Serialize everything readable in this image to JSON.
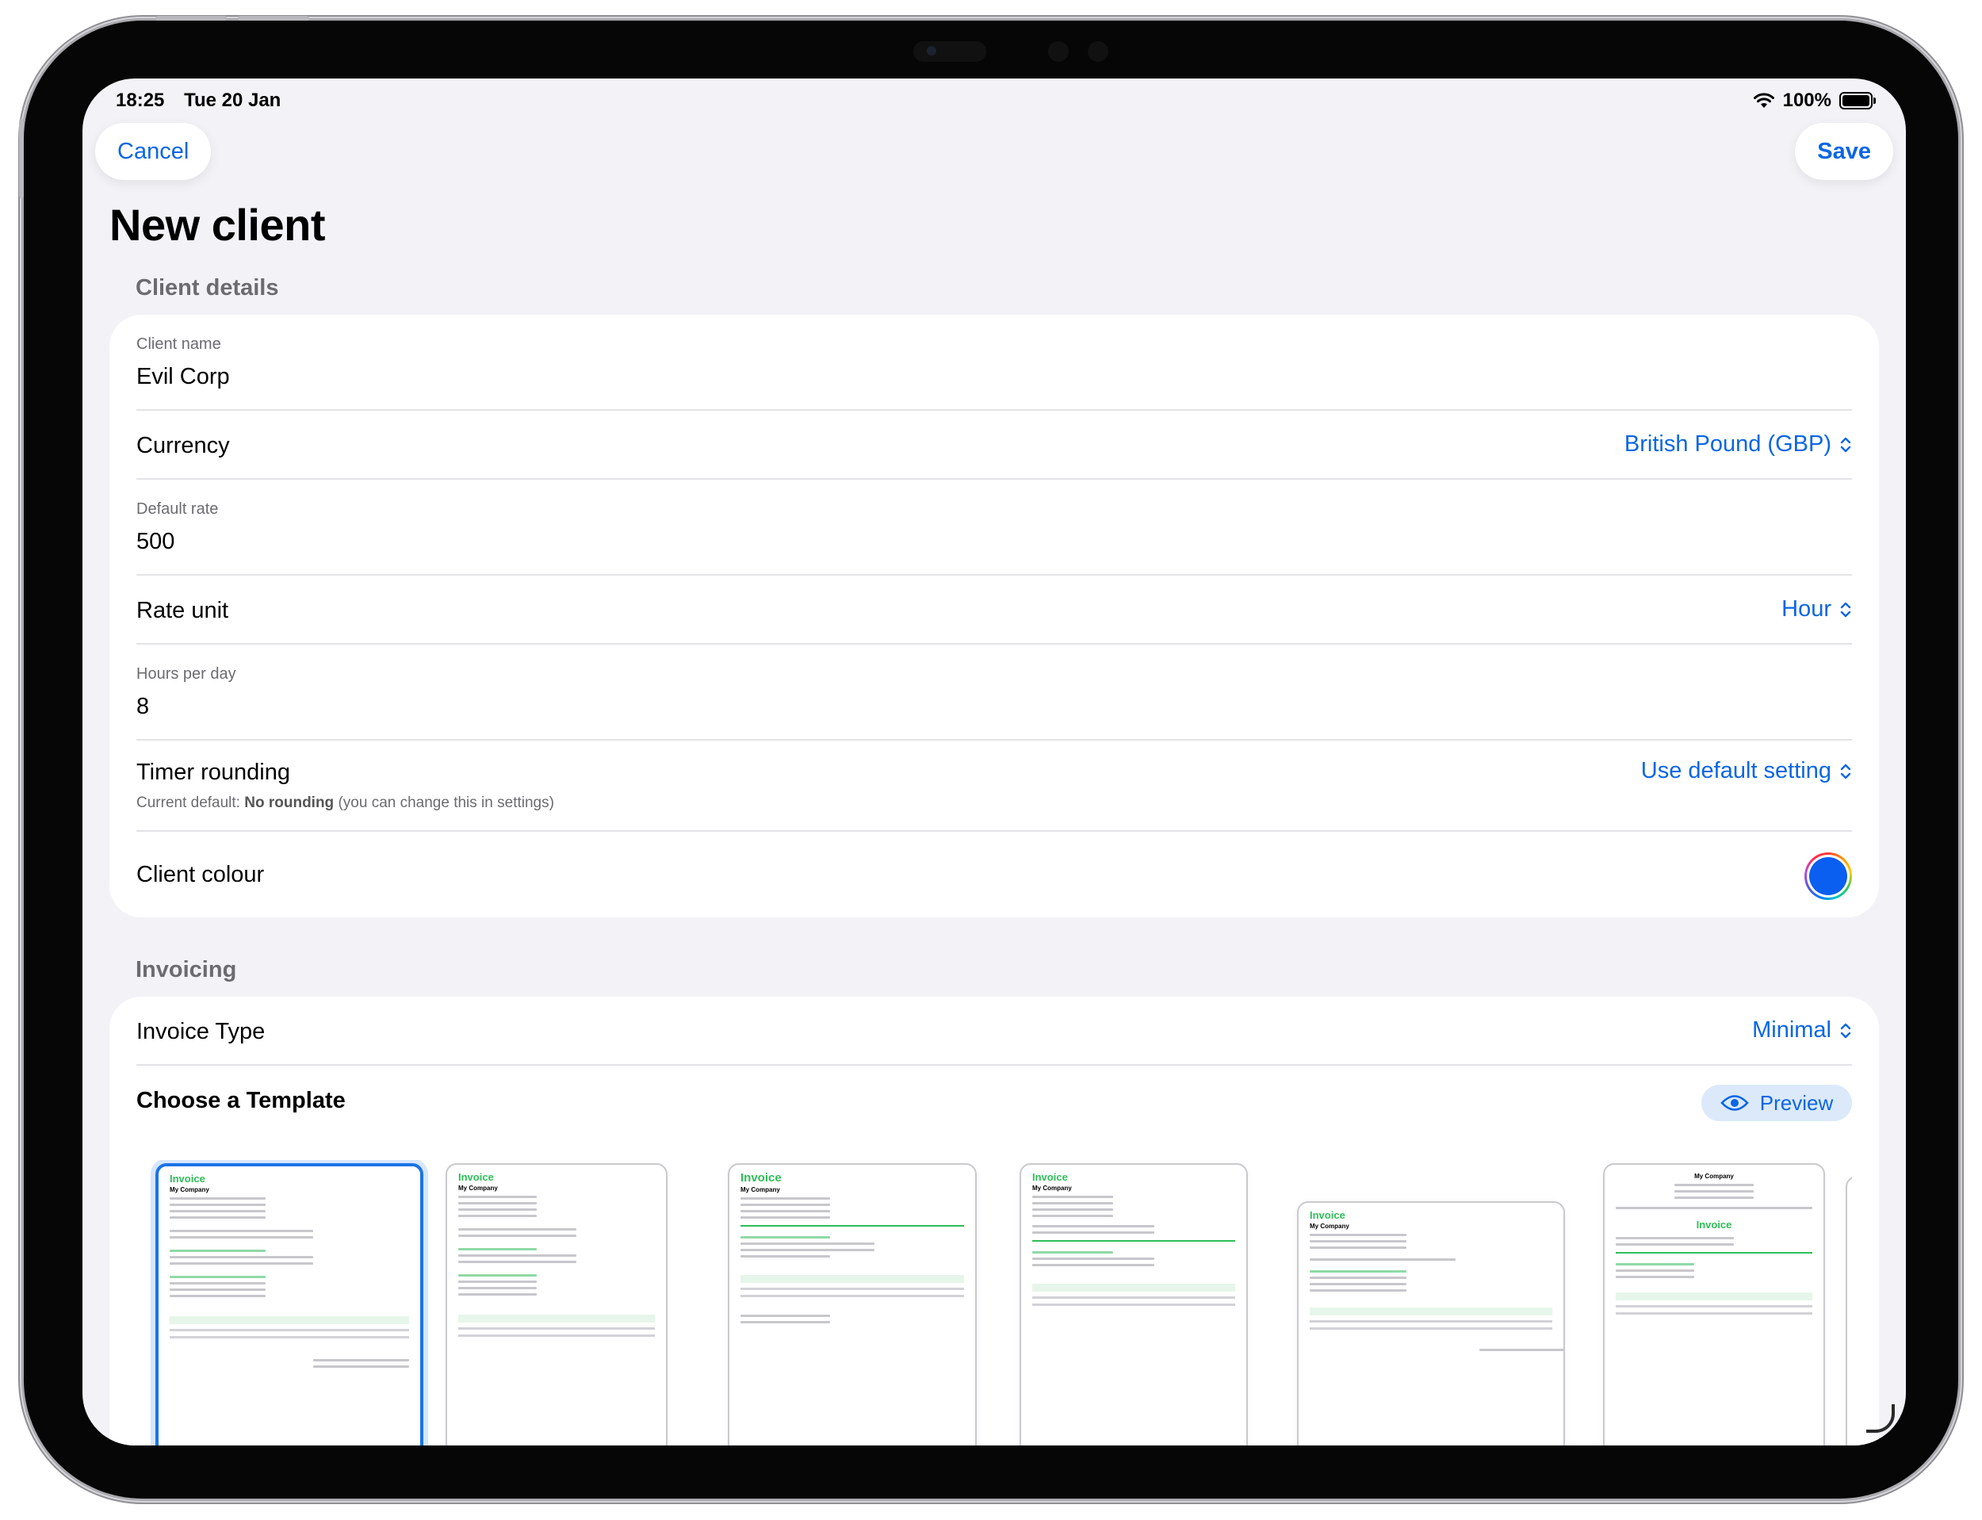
{
  "status_bar": {
    "time": "18:25",
    "date": "Tue 20 Jan",
    "battery": "100%"
  },
  "nav": {
    "cancel_label": "Cancel",
    "save_label": "Save",
    "title": "New client"
  },
  "client_details": {
    "section_label": "Client details",
    "client_name": {
      "label": "Client name",
      "value": "Evil Corp"
    },
    "currency": {
      "label": "Currency",
      "value": "British Pound (GBP)"
    },
    "default_rate": {
      "label": "Default rate",
      "value": "500"
    },
    "rate_unit": {
      "label": "Rate unit",
      "value": "Hour"
    },
    "hours_per_day": {
      "label": "Hours per day",
      "value": "8"
    },
    "timer_rounding": {
      "label": "Timer rounding",
      "value": "Use default setting",
      "sub_prefix": "Current default: ",
      "sub_bold": "No rounding",
      "sub_suffix": " (you can change this in settings)"
    },
    "client_colour": {
      "label": "Client colour",
      "color": "#0a5ef0"
    }
  },
  "invoicing": {
    "section_label": "Invoicing",
    "invoice_type": {
      "label": "Invoice Type",
      "value": "Minimal"
    },
    "template_title": "Choose a Template",
    "preview_label": "Preview",
    "template_heading_text": "Invoice",
    "template_company_text": "My Company"
  },
  "colors": {
    "accent": "#0a66e4",
    "invoice_green": "#2dbe57",
    "background": "#f2f2f7"
  }
}
